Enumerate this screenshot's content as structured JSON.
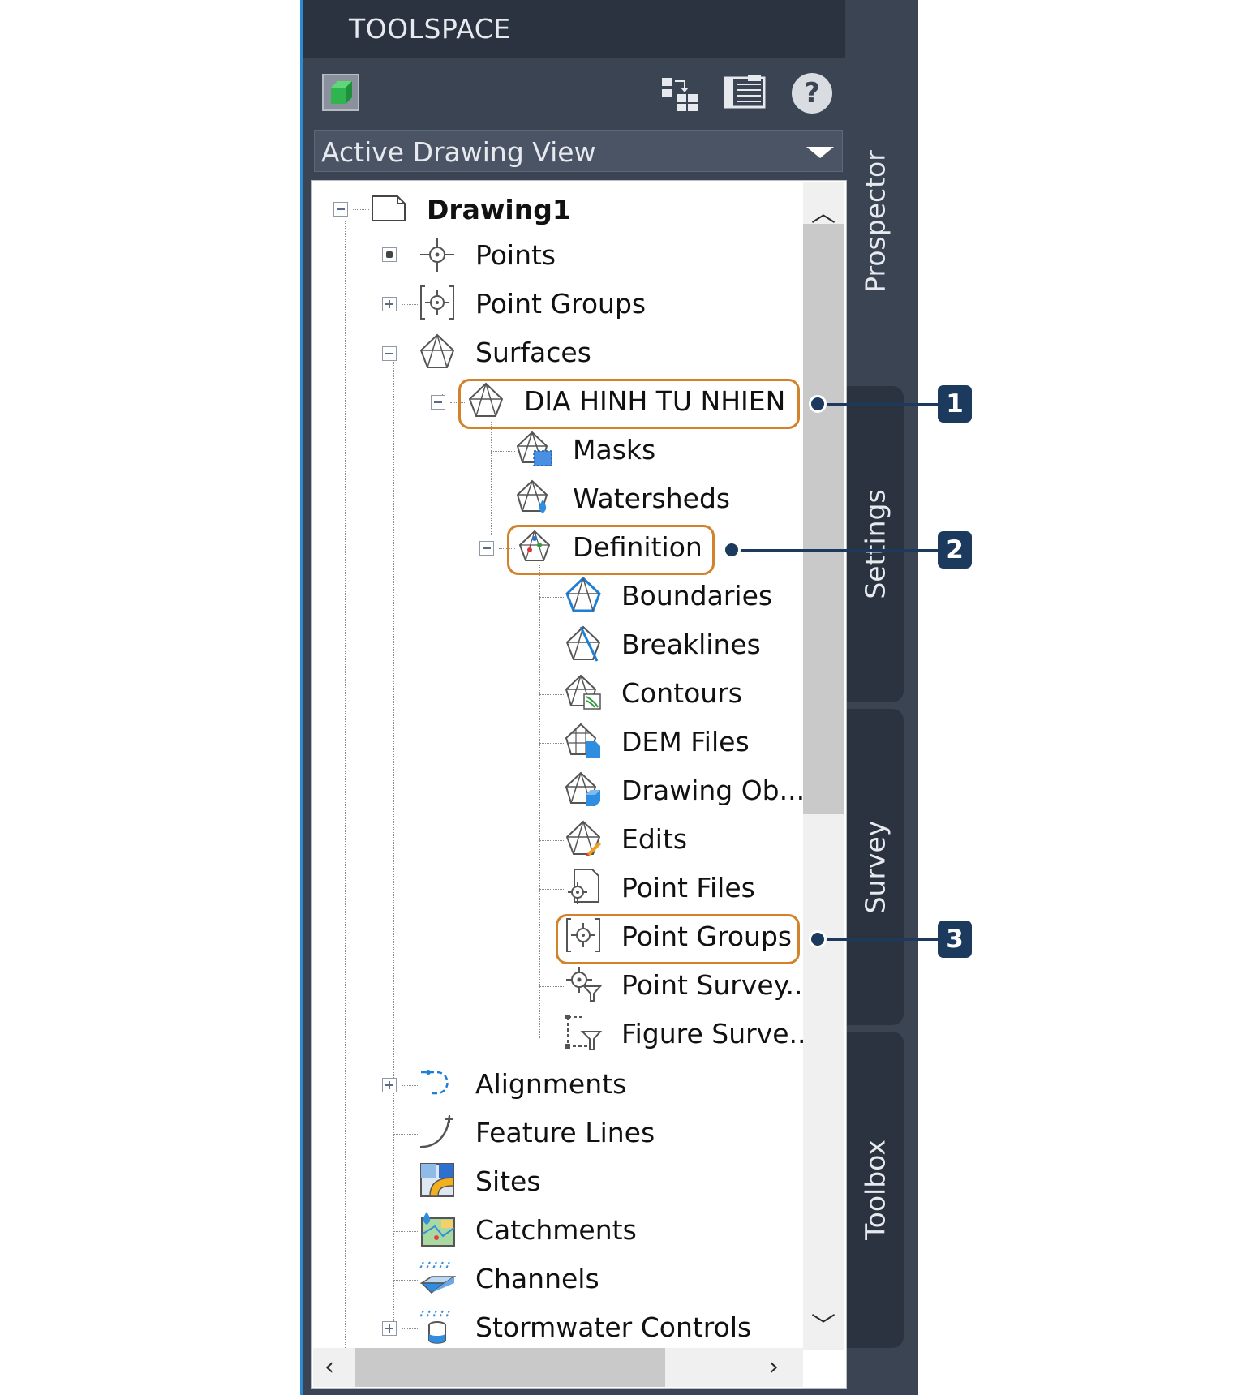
{
  "window": {
    "title": "TOOLSPACE"
  },
  "toolbar": {
    "buttons": [
      "cube-icon",
      "tree-view-icon",
      "list-panel-icon",
      "help-icon"
    ],
    "help_glyph": "?"
  },
  "view_selector": {
    "value": "Active Drawing View"
  },
  "tree": {
    "root": "Drawing1",
    "items": {
      "points": "Points",
      "point_groups": "Point Groups",
      "surfaces": "Surfaces",
      "surface_name": "DIA HINH TU NHIEN",
      "masks": "Masks",
      "watersheds": "Watersheds",
      "definition": "Definition",
      "boundaries": "Boundaries",
      "breaklines": "Breaklines",
      "contours": "Contours",
      "dem_files": "DEM Files",
      "drawing_objects": "Drawing Ob...",
      "edits": "Edits",
      "point_files": "Point Files",
      "def_point_groups": "Point Groups",
      "point_survey": "Point Survey...",
      "figure_survey": "Figure Surve...",
      "alignments": "Alignments",
      "feature_lines": "Feature Lines",
      "sites": "Sites",
      "catchments": "Catchments",
      "channels": "Channels",
      "stormwater": "Stormwater Controls"
    }
  },
  "tabs": {
    "prospector": "Prospector",
    "settings": "Settings",
    "survey": "Survey",
    "toolbox": "Toolbox"
  },
  "callouts": [
    "1",
    "2",
    "3"
  ],
  "colors": {
    "highlight": "#d1822a",
    "callout": "#1b3a5e",
    "panel": "#3b4453"
  }
}
